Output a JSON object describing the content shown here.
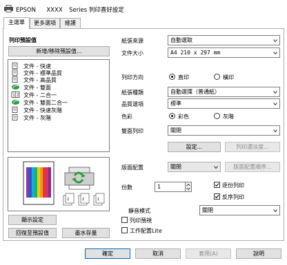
{
  "window": {
    "brand": "EPSON",
    "model": "XXXX",
    "title": "Series 列印喜好設定"
  },
  "tabs": [
    "主選單",
    "更多選項",
    "維護"
  ],
  "presets": {
    "heading": "列印預設值",
    "add_remove_button": "新增/移除預設值...",
    "items": [
      {
        "label": "文件 - 快速",
        "icon": "document-icon"
      },
      {
        "label": "文件 - 標準品質",
        "icon": "document-icon"
      },
      {
        "label": "文件 - 高品質",
        "icon": "document-icon"
      },
      {
        "label": "文件 - 雙面",
        "icon": "eco-icon"
      },
      {
        "label": "文件 - 二合一",
        "icon": "pages-per-sheet-icon"
      },
      {
        "label": "文件 - 雙面二合一",
        "icon": "eco-icon"
      },
      {
        "label": "文件 - 快速灰階",
        "icon": "document-icon"
      },
      {
        "label": "文件 - 灰階",
        "icon": "document-icon"
      }
    ],
    "show_settings_button": "顯示設定",
    "restore_defaults_button": "回復至預設值",
    "ink_levels_button": "墨水存量"
  },
  "settings": {
    "paper_source": {
      "label": "紙張來源",
      "value": "自動選取"
    },
    "paper_size": {
      "label": "文件大小",
      "value": "A4 210 x 297 mm"
    },
    "orientation": {
      "label": "列印方向",
      "options": [
        "直印",
        "橫印"
      ],
      "selected": "直印"
    },
    "paper_type": {
      "label": "紙張種類",
      "value": "自動選擇（普通紙）"
    },
    "quality": {
      "label": "品質選項",
      "value": "標準"
    },
    "color": {
      "label": "色彩",
      "options": [
        "彩色",
        "灰階"
      ],
      "selected": "彩色"
    },
    "two_sided": {
      "label": "雙面列印",
      "value": "關閉"
    },
    "two_sided_settings_button": "設定...",
    "print_density_button": "列印濃淡度...",
    "multi_page": {
      "label": "版面配置",
      "value": "關閉",
      "order_button": "版面配置順序..."
    },
    "copies": {
      "label": "份數",
      "value": "1"
    },
    "collate": {
      "label": "逐份列印",
      "checked": true
    },
    "reverse_order": {
      "label": "反序列印",
      "checked": true
    },
    "quiet_mode": {
      "label": "靜音模式",
      "value": "關閉"
    },
    "print_preview": {
      "label": "列印預視",
      "checked": false
    },
    "job_arranger_lite": {
      "label": "工作配置Lite",
      "checked": false
    }
  },
  "footer": {
    "ok": "確定",
    "cancel": "取消",
    "apply": "套用(A)",
    "help": "說明"
  },
  "colors": {
    "button_face": "#e1e1e1",
    "border": "#adadad",
    "eco_green": "#2a9d3a",
    "accent_blue": "#0067c0"
  }
}
